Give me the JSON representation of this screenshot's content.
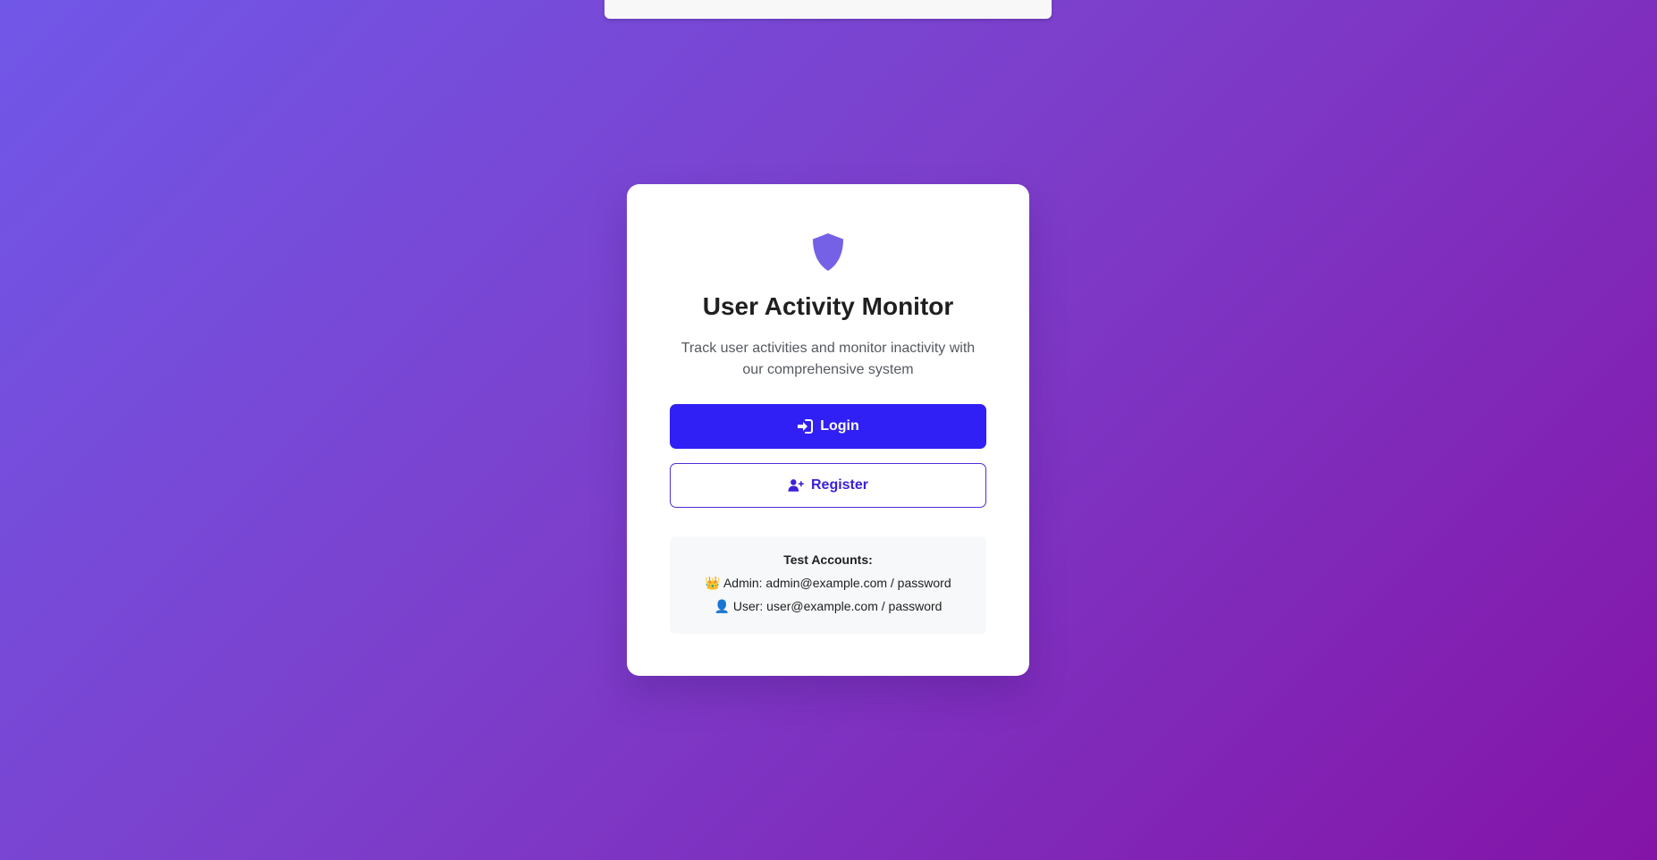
{
  "app": {
    "title": "User Activity Monitor",
    "subtitle": "Track user activities and monitor inactivity with our comprehensive system"
  },
  "actions": {
    "login_label": "Login",
    "register_label": "Register"
  },
  "test_accounts": {
    "heading": "Test Accounts:",
    "admin": {
      "icon": "crown-icon",
      "glyph": "👑",
      "text": "Admin: admin@example.com / password"
    },
    "user": {
      "icon": "user-icon",
      "glyph": "👤",
      "text": "User: user@example.com / password"
    }
  },
  "colors": {
    "accent": "#3120f5",
    "shield": "#7461e6",
    "gradient_start": "#7157e8",
    "gradient_end": "#8414a8"
  }
}
